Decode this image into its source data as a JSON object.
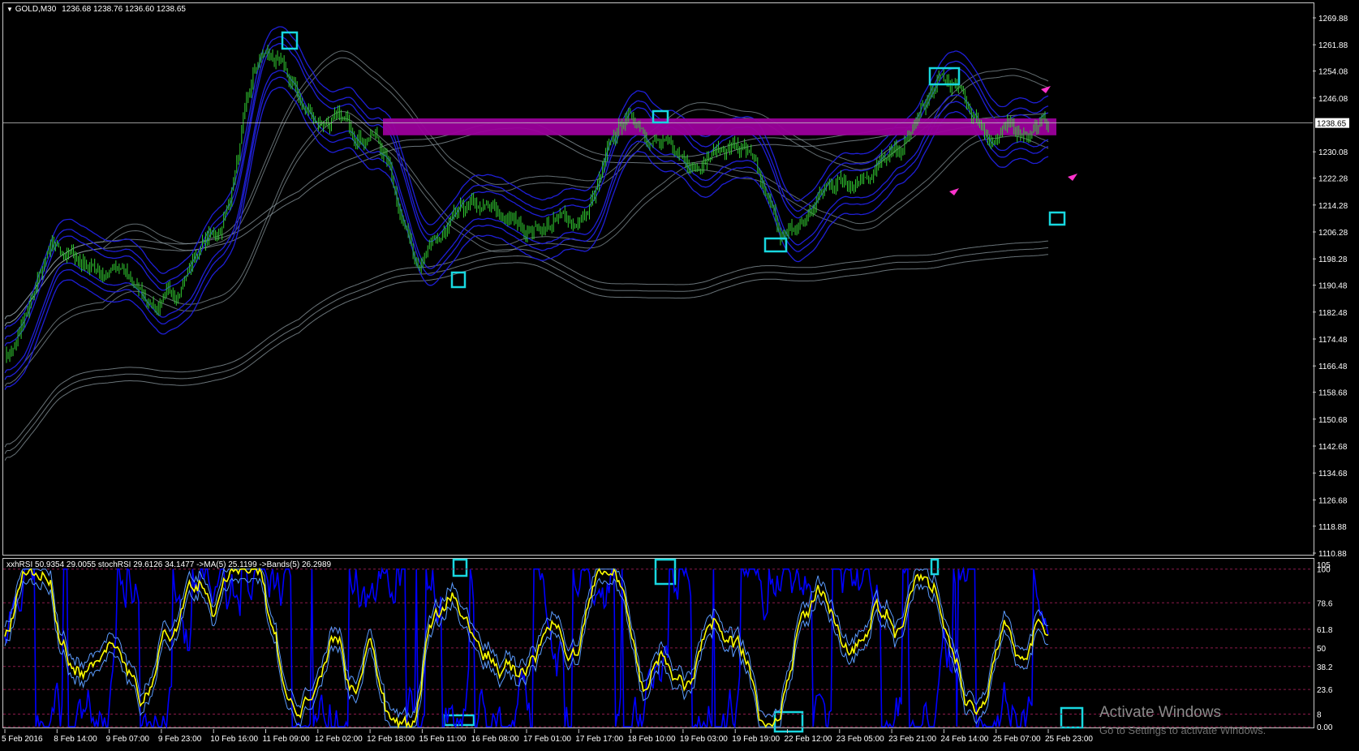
{
  "window": {
    "symbol_title": "GOLD,M30",
    "ohlc": "1236.68 1238.76 1236.60 1238.65",
    "collapse_glyph": "▼"
  },
  "price_axis": {
    "labels": [
      "1269.88",
      "1261.88",
      "1254.08",
      "1246.08",
      "1238.65",
      "1230.08",
      "1222.28",
      "1214.28",
      "1206.28",
      "1198.28",
      "1190.48",
      "1182.48",
      "1174.48",
      "1166.48",
      "1158.68",
      "1150.68",
      "1142.68",
      "1134.68",
      "1126.68",
      "1118.88",
      "1110.88"
    ],
    "current_price": "1238.65",
    "min": 1110.88,
    "max": 1269.88
  },
  "indicator": {
    "legend": "xxhRSI 50.9354 29.0055  stochRSI 29.6126 34.1477  ->MA(5) 25.1199  ->Bands(5) 26.2989",
    "levels": [
      "100",
      "78.6",
      "61.8",
      "50",
      "38.2",
      "23.6",
      "8",
      "0.00"
    ],
    "top_label": "105"
  },
  "time_axis": {
    "labels": [
      "5 Feb 2016",
      "8 Feb 14:00",
      "9 Feb 07:00",
      "9 Feb 23:00",
      "10 Feb 16:00",
      "11 Feb 09:00",
      "12 Feb 02:00",
      "12 Feb 18:00",
      "15 Feb 11:00",
      "16 Feb 08:00",
      "17 Feb 01:00",
      "17 Feb 17:00",
      "18 Feb 10:00",
      "19 Feb 03:00",
      "19 Feb 19:00",
      "22 Feb 12:00",
      "23 Feb 05:00",
      "23 Feb 21:00",
      "24 Feb 14:00",
      "25 Feb 07:00",
      "25 Feb 23:00"
    ]
  },
  "colors": {
    "background": "#000000",
    "bullish_candle": "#32cd32",
    "band_blue": "#1f1fd6",
    "band_grey": "#8c9aa0",
    "highlight_zone": "#9b009b",
    "signal_box": "#18d8e0",
    "rsi_yellow": "#ffff00",
    "rsi_blue": "#0000ff",
    "level_line": "#8b1a4a"
  },
  "chart_data": {
    "type": "candlestick",
    "symbol": "GOLD",
    "timeframe": "M30",
    "ylim": [
      1110.88,
      1269.88
    ],
    "approx_close_path": [
      {
        "x": "5 Feb 2016",
        "y": 1170
      },
      {
        "x": "8 Feb 14:00",
        "y": 1200
      },
      {
        "x": "9 Feb 07:00",
        "y": 1195
      },
      {
        "x": "9 Feb 23:00",
        "y": 1185
      },
      {
        "x": "10 Feb 16:00",
        "y": 1205
      },
      {
        "x": "11 Feb 09:00",
        "y": 1258
      },
      {
        "x": "12 Feb 02:00",
        "y": 1240
      },
      {
        "x": "12 Feb 18:00",
        "y": 1236
      },
      {
        "x": "15 Feb 11:00",
        "y": 1200
      },
      {
        "x": "16 Feb 08:00",
        "y": 1212
      },
      {
        "x": "17 Feb 01:00",
        "y": 1208
      },
      {
        "x": "17 Feb 17:00",
        "y": 1210
      },
      {
        "x": "18 Feb 10:00",
        "y": 1240
      },
      {
        "x": "19 Feb 03:00",
        "y": 1228
      },
      {
        "x": "19 Feb 19:00",
        "y": 1232
      },
      {
        "x": "22 Feb 12:00",
        "y": 1205
      },
      {
        "x": "23 Feb 05:00",
        "y": 1222
      },
      {
        "x": "23 Feb 21:00",
        "y": 1228
      },
      {
        "x": "24 Feb 14:00",
        "y": 1250
      },
      {
        "x": "25 Feb 07:00",
        "y": 1235
      },
      {
        "x": "25 Feb 23:00",
        "y": 1238.65
      }
    ]
  }
}
